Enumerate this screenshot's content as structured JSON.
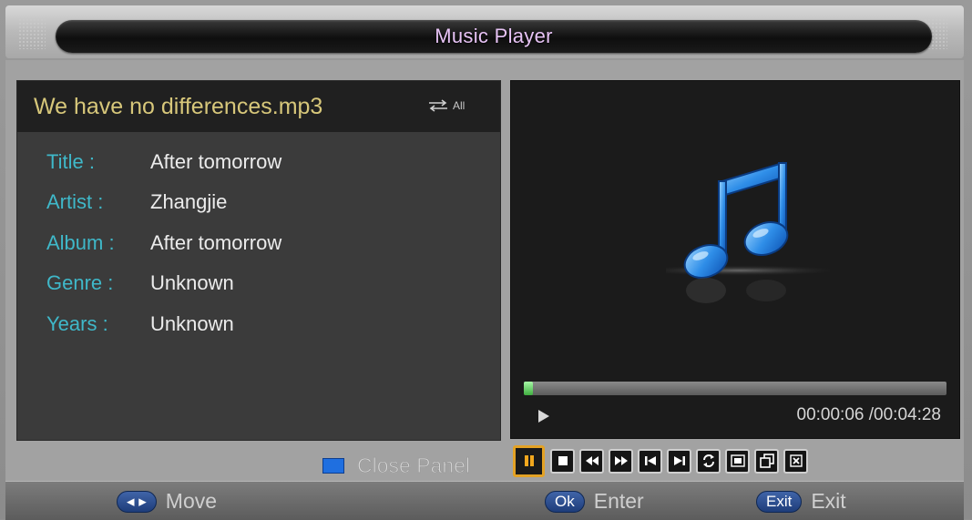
{
  "header": {
    "title": "Music Player"
  },
  "track": {
    "file_name": "We have no differences.mp3",
    "repeat_mode": "All",
    "fields": [
      {
        "label": "Title :",
        "value": "After tomorrow"
      },
      {
        "label": "Artist :",
        "value": "Zhangjie"
      },
      {
        "label": "Album :",
        "value": "After tomorrow"
      },
      {
        "label": "Genre :",
        "value": "Unknown"
      },
      {
        "label": "Years :",
        "value": "Unknown"
      }
    ]
  },
  "playback": {
    "time": "00:00:06 /00:04:28",
    "progress": 0.022,
    "state": "play-icon"
  },
  "controls": {
    "close_panel_label": "Close Panel",
    "buttons": [
      {
        "icon": "pause-icon",
        "active": true
      },
      {
        "icon": "stop-icon",
        "active": false
      },
      {
        "icon": "rewind-icon",
        "active": false
      },
      {
        "icon": "fast-forward-icon",
        "active": false
      },
      {
        "icon": "previous-track-icon",
        "active": false
      },
      {
        "icon": "next-track-icon",
        "active": false
      },
      {
        "icon": "repeat-icon",
        "active": false
      },
      {
        "icon": "ab-repeat-icon",
        "active": false
      },
      {
        "icon": "playlist-icon",
        "active": false
      },
      {
        "icon": "close-icon",
        "active": false
      }
    ]
  },
  "footer": {
    "move_key": "◂ ▸",
    "move_label": "Move",
    "ok_key": "Ok",
    "ok_label": "Enter",
    "exit_key": "Exit",
    "exit_label": "Exit"
  },
  "colors": {
    "accent_title": "#e7c3f5",
    "field_label": "#3fb8c9",
    "file_name": "#d7c77a",
    "active_control": "#e3a225",
    "close_panel_key": "#1f6fe0"
  }
}
